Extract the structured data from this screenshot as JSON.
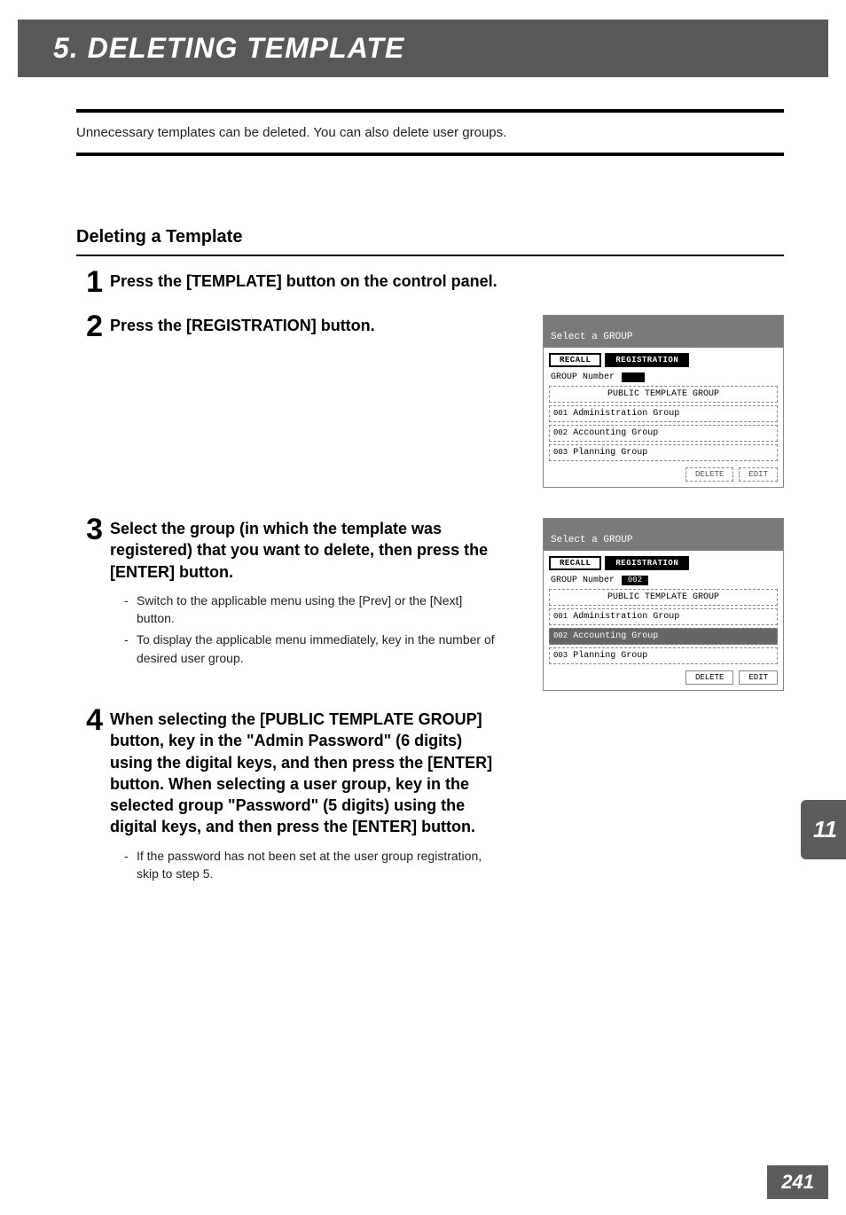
{
  "chapter": {
    "title": "5. DELETING TEMPLATE"
  },
  "intro": "Unnecessary templates can be deleted. You can also delete user groups.",
  "section": {
    "title": "Deleting a Template"
  },
  "steps": [
    {
      "num": "1",
      "text": "Press the [TEMPLATE] button on the control panel."
    },
    {
      "num": "2",
      "text": "Press the [REGISTRATION] button."
    },
    {
      "num": "3",
      "text": "Select the group (in which the template was registered) that you want to delete, then press the [ENTER] button.",
      "subs": [
        "Switch to the applicable menu using the [Prev] or the [Next] button.",
        "To display the applicable menu immediately, key in the number of desired user group."
      ]
    },
    {
      "num": "4",
      "text": "When selecting the [PUBLIC TEMPLATE GROUP] button, key in the \"Admin Password\" (6 digits) using the digital keys, and then press the [ENTER] button. When selecting a user group, key in the selected group \"Password\" (5 digits) using the digital keys, and then press the [ENTER] button.",
      "subs": [
        "If the password has not been set at the user group registration, skip to step 5."
      ]
    }
  ],
  "device": {
    "header": "Select a GROUP",
    "tabs": {
      "recall": "RECALL",
      "registration": "REGISTRATION"
    },
    "group_number_label": "GROUP Number",
    "group_number_value": "002",
    "rows": [
      {
        "idx": "",
        "label": "PUBLIC TEMPLATE GROUP"
      },
      {
        "idx": "001",
        "label": "Administration Group"
      },
      {
        "idx": "002",
        "label": "Accounting Group"
      },
      {
        "idx": "003",
        "label": "Planning Group"
      }
    ],
    "buttons": {
      "delete": "DELETE",
      "edit": "EDIT"
    }
  },
  "side_tab": "11",
  "page_number": "241"
}
